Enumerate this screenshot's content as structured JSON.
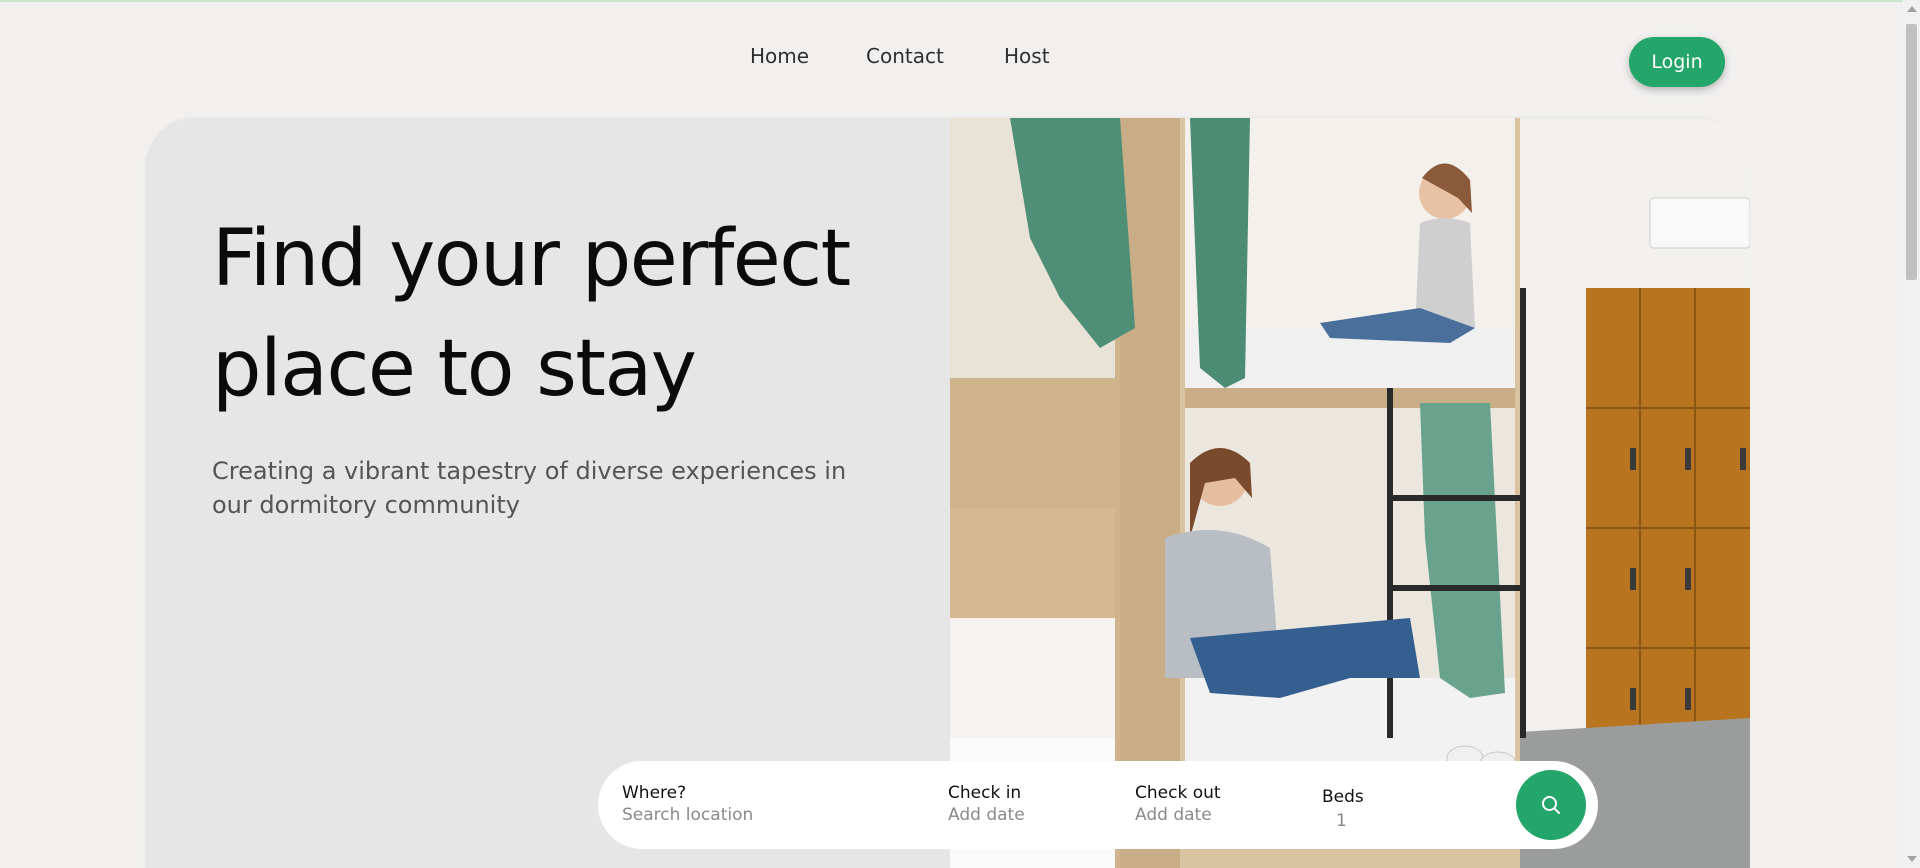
{
  "nav": {
    "links": [
      {
        "label": "Home"
      },
      {
        "label": "Contact"
      },
      {
        "label": "Host"
      }
    ],
    "login_label": "Login"
  },
  "hero": {
    "title_line1": "Find your perfect",
    "title_line2": "place to stay",
    "subtitle": "Creating a vibrant tapestry of diverse experiences in our dormitory community"
  },
  "search": {
    "where_label": "Where?",
    "where_placeholder": "Search location",
    "checkin_label": "Check in",
    "checkin_placeholder": "Add date",
    "checkout_label": "Check out",
    "checkout_placeholder": "Add date",
    "beds_label": "Beds",
    "beds_value": "1",
    "button_icon": "search-icon"
  },
  "colors": {
    "accent": "#24a56a",
    "background": "#f1f0ef",
    "hero_panel": "#e6e6e6"
  }
}
